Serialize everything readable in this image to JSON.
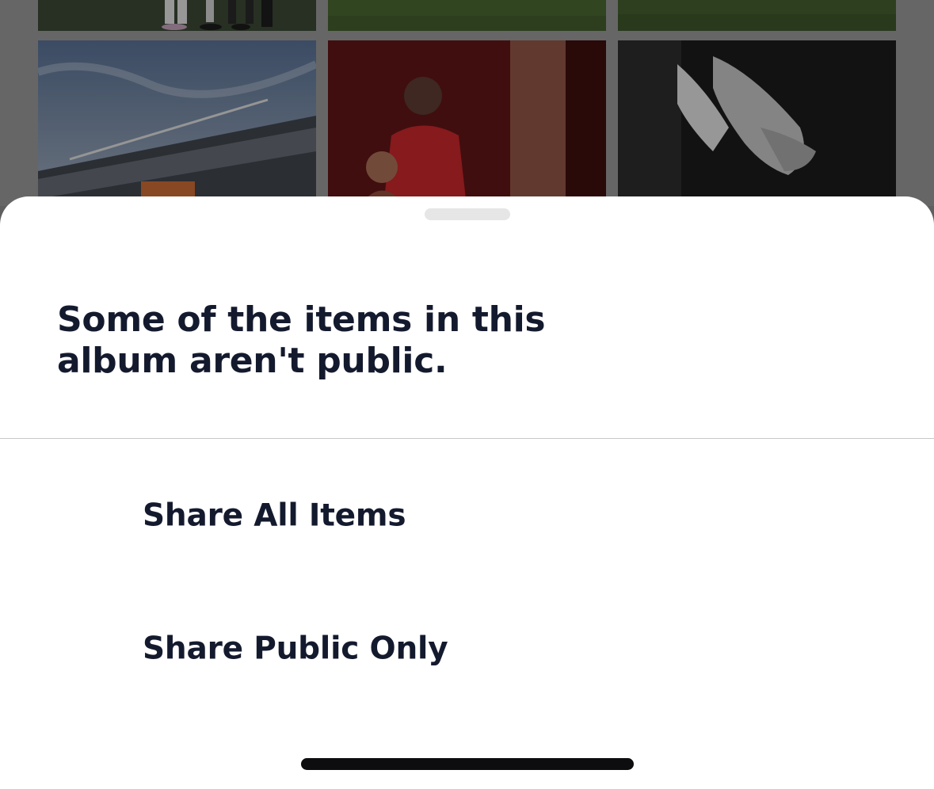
{
  "sheet": {
    "title": "Some of the items in this album aren't public.",
    "actions": {
      "share_all": "Share All Items",
      "share_public": "Share Public Only"
    }
  },
  "background": {
    "photos": [
      "players-legs-photo",
      "grass-pitch-photo",
      "grass-pitch-photo",
      "stadium-stand-photo",
      "player-with-child-photo",
      "holding-hands-photo"
    ]
  },
  "colors": {
    "sheet_bg": "#ffffff",
    "text": "#141a2e",
    "overlay_dim": "#666666"
  }
}
